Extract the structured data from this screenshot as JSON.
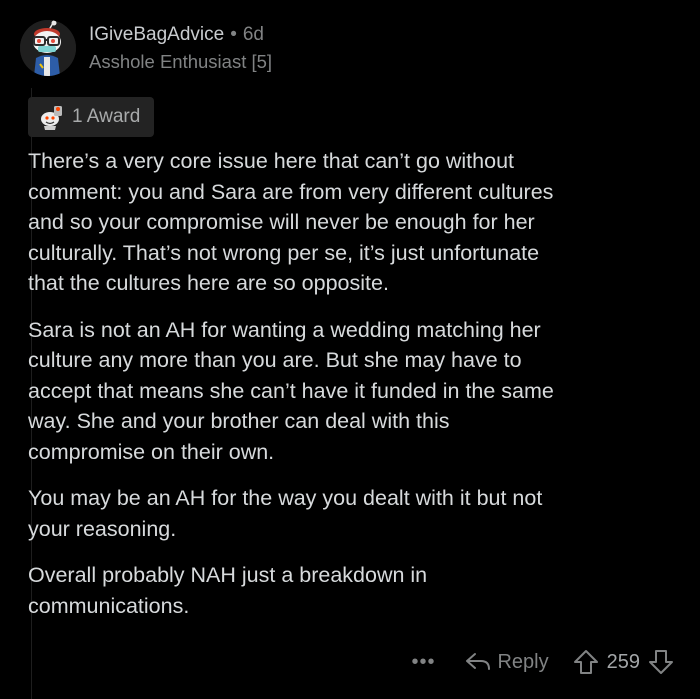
{
  "comment": {
    "author": "IGiveBagAdvice",
    "separator": "•",
    "age": "6d",
    "flair": "Asshole Enthusiast [5]",
    "award_label": "1 Award",
    "paragraphs": [
      "There’s a very core issue here that can’t go without\ncomment: you and Sara are from very different cultures\nand so your compromise will never be enough for her\nculturally. That’s not wrong per se, it’s just unfortunate\nthat the cultures here are so opposite.",
      "Sara is not an AH for wanting a wedding matching her\nculture any more than you are. But she may have to\naccept that means she can’t have it funded in the same\nway. She and your brother can deal with this\ncompromise on their own.",
      "You may be an AH for the way you dealt with it but not\nyour reasoning.",
      "Overall probably NAH just a breakdown in\ncommunications."
    ]
  },
  "actions": {
    "more_label": "•••",
    "reply_label": "Reply",
    "score": "259"
  },
  "icons": {
    "avatar": "snoo-avatar",
    "award": "award-icon",
    "reply": "reply-arrow-icon",
    "upvote": "upvote-arrow-icon",
    "downvote": "downvote-arrow-icon",
    "more": "more-options-icon"
  },
  "colors": {
    "background": "#000000",
    "text": "#d7dadc",
    "muted": "#818384"
  }
}
